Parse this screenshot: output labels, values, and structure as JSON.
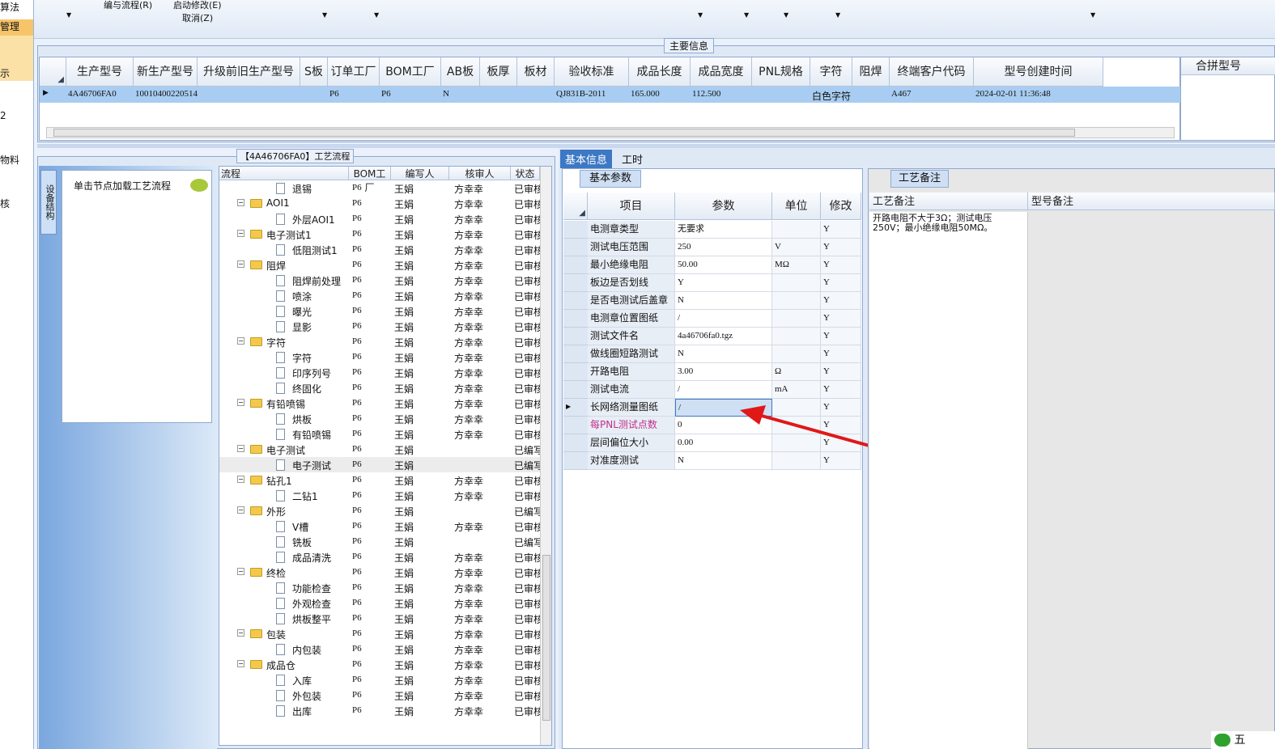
{
  "left_strip": [
    "算法",
    "管理",
    "示",
    "2",
    "物料",
    "核"
  ],
  "toolbar": {
    "edit_flow": "编与流程(R)",
    "start_modify": "启动修改(E)",
    "cancel": "取消(Z)"
  },
  "main_info": {
    "title": "主要信息",
    "columns": [
      "生产型号",
      "新生产型号",
      "升级前旧生产型号",
      "S板",
      "订单工厂",
      "BOM工厂",
      "AB板",
      "板厚",
      "板材",
      "验收标准",
      "成品长度",
      "成品宽度",
      "PNL规格",
      "字符",
      "阻焊",
      "终端客户代码",
      "型号创建时间"
    ],
    "row": [
      "4A46706FA0",
      "10010400220514",
      "",
      "",
      "P6",
      "P6",
      "N",
      "",
      "",
      "QJ831B-2011",
      "165.000",
      "112.500",
      "",
      "白色字符",
      "",
      "A467",
      "2024-02-01 11:36:48"
    ],
    "merge_header": "合拼型号"
  },
  "flow_panel": {
    "title": "【4A46706FA0】工艺流程",
    "side_tab": "设备结构",
    "hint": "单击节点加载工艺流程",
    "columns": [
      "流程",
      "BOM工厂",
      "编写人",
      "核审人",
      "状态"
    ],
    "rows": [
      {
        "name": "退锡",
        "lvl": 2,
        "f": "P6",
        "w": "王娟",
        "r": "方幸幸",
        "s": "已审核"
      },
      {
        "name": "AOI1",
        "lvl": 1,
        "f": "P6",
        "w": "王娟",
        "r": "方幸幸",
        "s": "已审核"
      },
      {
        "name": "外层AOI1",
        "lvl": 2,
        "f": "P6",
        "w": "王娟",
        "r": "方幸幸",
        "s": "已审核"
      },
      {
        "name": "电子测试1",
        "lvl": 1,
        "f": "P6",
        "w": "王娟",
        "r": "方幸幸",
        "s": "已审核"
      },
      {
        "name": "低阻测试1",
        "lvl": 2,
        "f": "P6",
        "w": "王娟",
        "r": "方幸幸",
        "s": "已审核"
      },
      {
        "name": "阻焊",
        "lvl": 1,
        "f": "P6",
        "w": "王娟",
        "r": "方幸幸",
        "s": "已审核"
      },
      {
        "name": "阻焊前处理",
        "lvl": 2,
        "f": "P6",
        "w": "王娟",
        "r": "方幸幸",
        "s": "已审核"
      },
      {
        "name": "喷涂",
        "lvl": 2,
        "f": "P6",
        "w": "王娟",
        "r": "方幸幸",
        "s": "已审核"
      },
      {
        "name": "曝光",
        "lvl": 2,
        "f": "P6",
        "w": "王娟",
        "r": "方幸幸",
        "s": "已审核"
      },
      {
        "name": "显影",
        "lvl": 2,
        "f": "P6",
        "w": "王娟",
        "r": "方幸幸",
        "s": "已审核"
      },
      {
        "name": "字符",
        "lvl": 1,
        "f": "P6",
        "w": "王娟",
        "r": "方幸幸",
        "s": "已审核"
      },
      {
        "name": "字符",
        "lvl": 2,
        "f": "P6",
        "w": "王娟",
        "r": "方幸幸",
        "s": "已审核"
      },
      {
        "name": "印序列号",
        "lvl": 2,
        "f": "P6",
        "w": "王娟",
        "r": "方幸幸",
        "s": "已审核"
      },
      {
        "name": "终固化",
        "lvl": 2,
        "f": "P6",
        "w": "王娟",
        "r": "方幸幸",
        "s": "已审核"
      },
      {
        "name": "有铅喷锡",
        "lvl": 1,
        "f": "P6",
        "w": "王娟",
        "r": "方幸幸",
        "s": "已审核"
      },
      {
        "name": "烘板",
        "lvl": 2,
        "f": "P6",
        "w": "王娟",
        "r": "方幸幸",
        "s": "已审核"
      },
      {
        "name": "有铅喷锡",
        "lvl": 2,
        "f": "P6",
        "w": "王娟",
        "r": "方幸幸",
        "s": "已审核"
      },
      {
        "name": "电子测试",
        "lvl": 1,
        "f": "P6",
        "w": "王娟",
        "r": "",
        "s": "已编写"
      },
      {
        "name": "电子测试",
        "lvl": 2,
        "f": "P6",
        "w": "王娟",
        "r": "",
        "s": "已编写"
      },
      {
        "name": "钻孔1",
        "lvl": 1,
        "f": "P6",
        "w": "王娟",
        "r": "方幸幸",
        "s": "已审核"
      },
      {
        "name": "二钻1",
        "lvl": 2,
        "f": "P6",
        "w": "王娟",
        "r": "方幸幸",
        "s": "已审核"
      },
      {
        "name": "外形",
        "lvl": 1,
        "f": "P6",
        "w": "王娟",
        "r": "",
        "s": "已编写"
      },
      {
        "name": "V槽",
        "lvl": 2,
        "f": "P6",
        "w": "王娟",
        "r": "方幸幸",
        "s": "已审核"
      },
      {
        "name": "铣板",
        "lvl": 2,
        "f": "P6",
        "w": "王娟",
        "r": "",
        "s": "已编写"
      },
      {
        "name": "成品清洗",
        "lvl": 2,
        "f": "P6",
        "w": "王娟",
        "r": "方幸幸",
        "s": "已审核"
      },
      {
        "name": "终检",
        "lvl": 1,
        "f": "P6",
        "w": "王娟",
        "r": "方幸幸",
        "s": "已审核"
      },
      {
        "name": "功能检查",
        "lvl": 2,
        "f": "P6",
        "w": "王娟",
        "r": "方幸幸",
        "s": "已审核"
      },
      {
        "name": "外观检查",
        "lvl": 2,
        "f": "P6",
        "w": "王娟",
        "r": "方幸幸",
        "s": "已审核"
      },
      {
        "name": "烘板整平",
        "lvl": 2,
        "f": "P6",
        "w": "王娟",
        "r": "方幸幸",
        "s": "已审核"
      },
      {
        "name": "包装",
        "lvl": 1,
        "f": "P6",
        "w": "王娟",
        "r": "方幸幸",
        "s": "已审核"
      },
      {
        "name": "内包装",
        "lvl": 2,
        "f": "P6",
        "w": "王娟",
        "r": "方幸幸",
        "s": "已审核"
      },
      {
        "name": "成品仓",
        "lvl": 1,
        "f": "P6",
        "w": "王娟",
        "r": "方幸幸",
        "s": "已审核"
      },
      {
        "name": "入库",
        "lvl": 2,
        "f": "P6",
        "w": "王娟",
        "r": "方幸幸",
        "s": "已审核"
      },
      {
        "name": "外包装",
        "lvl": 2,
        "f": "P6",
        "w": "王娟",
        "r": "方幸幸",
        "s": "已审核"
      },
      {
        "name": "出库",
        "lvl": 2,
        "f": "P6",
        "w": "王娟",
        "r": "方幸幸",
        "s": "已审核"
      }
    ]
  },
  "right_tabs": [
    "基本信息",
    "工时"
  ],
  "basic_params": {
    "tab": "基本参数",
    "columns": [
      "项目",
      "参数",
      "单位",
      "修改"
    ],
    "rows": [
      {
        "item": "电测章类型",
        "param": "无要求",
        "unit": "",
        "mod": "Y"
      },
      {
        "item": "测试电压范围",
        "param": "250",
        "unit": "V",
        "mod": "Y"
      },
      {
        "item": "最小绝缘电阻",
        "param": "50.00",
        "unit": "MΩ",
        "mod": "Y"
      },
      {
        "item": "板边是否划线",
        "param": "Y",
        "unit": "",
        "mod": "Y"
      },
      {
        "item": "是否电测试后盖章",
        "param": "N",
        "unit": "",
        "mod": "Y"
      },
      {
        "item": "电测章位置图纸",
        "param": "/",
        "unit": "",
        "mod": "Y"
      },
      {
        "item": "测试文件名",
        "param": "4a46706fa0.tgz",
        "unit": "",
        "mod": "Y"
      },
      {
        "item": "做线圈短路测试",
        "param": "N",
        "unit": "",
        "mod": "Y"
      },
      {
        "item": "开路电阻",
        "param": "3.00",
        "unit": "Ω",
        "mod": "Y"
      },
      {
        "item": "测试电流",
        "param": "/",
        "unit": "mA",
        "mod": "Y"
      },
      {
        "item": "长网络测量图纸",
        "param": "/",
        "unit": "",
        "mod": "Y"
      },
      {
        "item": "每PNL测试点数",
        "param": "0",
        "unit": "",
        "mod": "Y"
      },
      {
        "item": "层间偏位大小",
        "param": "0.00",
        "unit": "",
        "mod": "Y"
      },
      {
        "item": "对准度测试",
        "param": "N",
        "unit": "",
        "mod": "Y"
      }
    ]
  },
  "process_notes": {
    "tab": "工艺备注",
    "col1": "工艺备注",
    "col2": "型号备注",
    "note": "开路电阻不大于3Ω；测试电压250V；最小绝缘电阻50MΩ。"
  },
  "tray": "五"
}
